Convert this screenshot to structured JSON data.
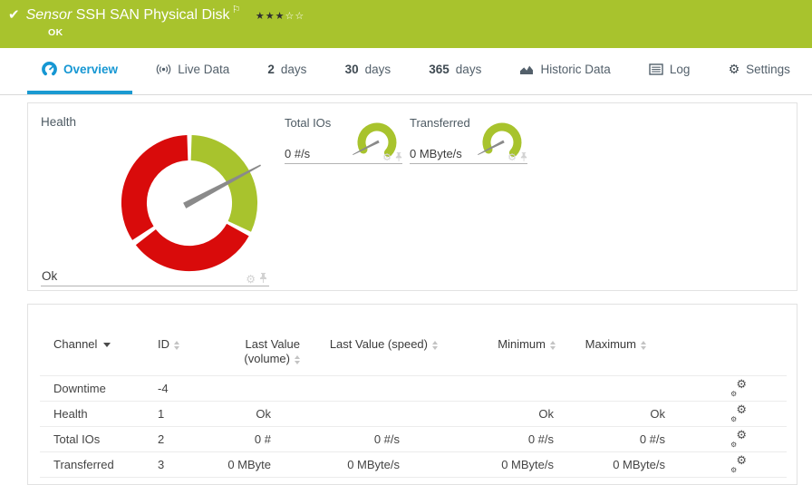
{
  "colors": {
    "brand_green": "#a8c32d",
    "status_red": "#d90b0b",
    "accent_blue": "#1697d3"
  },
  "header": {
    "check_icon": "✔",
    "type_label": "Sensor",
    "title": "SSH SAN Physical Disk",
    "flag_icon": "⚐",
    "stars_filled": "★★★",
    "stars_empty": "☆☆",
    "status": "OK"
  },
  "tabs": {
    "overview": "Overview",
    "live_data": "Live Data",
    "d2_num": "2",
    "d2_label": "days",
    "d30_num": "30",
    "d30_label": "days",
    "d365_num": "365",
    "d365_label": "days",
    "historic": "Historic Data",
    "log": "Log",
    "settings": "Settings",
    "settings_gear_icon": "⚙"
  },
  "dashboard": {
    "health": {
      "title": "Health",
      "status": "Ok",
      "gear_icon": "⚙"
    },
    "mini_gauges": [
      {
        "title": "Total IOs",
        "value": "0 #/s",
        "gear_icon": "⚙"
      },
      {
        "title": "Transferred",
        "value": "0 MByte/s",
        "gear_icon": "⚙"
      }
    ],
    "gauge_model": {
      "health": {
        "type": "donut-gauge",
        "status": "Ok",
        "segments": [
          {
            "color": "#a8c32d",
            "from_deg": 2,
            "to_deg": 115
          },
          {
            "color": "#d90b0b",
            "from_deg": 119,
            "to_deg": 232
          },
          {
            "color": "#d90b0b",
            "from_deg": 236,
            "to_deg": 358
          }
        ],
        "needle_deg": 62
      },
      "mini": {
        "type": "arc-gauge",
        "arc_from_deg": 242,
        "arc_to_deg": 133,
        "needle_deg": 243,
        "value": 0
      }
    }
  },
  "table": {
    "headers": {
      "channel": "Channel",
      "id": "ID",
      "volume_1": "Last Value",
      "volume_2": "(volume)",
      "speed": "Last Value (speed)",
      "min": "Minimum",
      "max": "Maximum"
    },
    "edit_gear_icon": "⚙",
    "rows": [
      {
        "channel": "Downtime",
        "id": "-4",
        "volume": "",
        "speed": "",
        "min": "",
        "max": ""
      },
      {
        "channel": "Health",
        "id": "1",
        "volume": "Ok",
        "speed": "",
        "min": "Ok",
        "max": "Ok"
      },
      {
        "channel": "Total IOs",
        "id": "2",
        "volume": "0 #",
        "speed": "0 #/s",
        "min": "0 #/s",
        "max": "0 #/s"
      },
      {
        "channel": "Transferred",
        "id": "3",
        "volume": "0 MByte",
        "speed": "0 MByte/s",
        "min": "0 MByte/s",
        "max": "0 MByte/s"
      }
    ]
  }
}
